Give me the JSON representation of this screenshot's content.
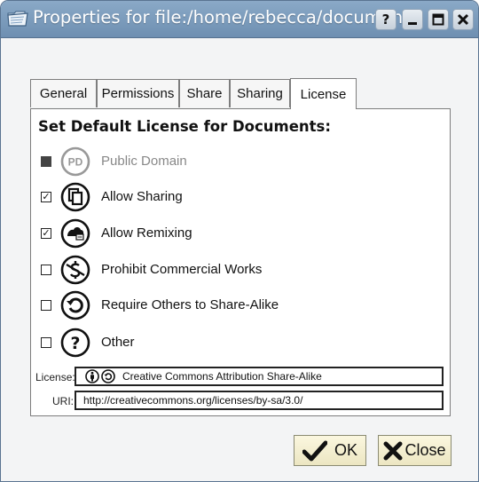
{
  "window": {
    "title": "Properties for file:/home/rebecca/documents"
  },
  "titlebar_buttons": [
    {
      "label": "?",
      "icon": "help-icon"
    },
    {
      "icon": "minimize-icon"
    },
    {
      "icon": "maximize-icon"
    },
    {
      "icon": "close-icon"
    }
  ],
  "tabs": [
    {
      "label": "General"
    },
    {
      "label": "Permissions"
    },
    {
      "label": "Share"
    },
    {
      "label": "Sharing"
    },
    {
      "label": "License",
      "active": true
    }
  ],
  "license_panel": {
    "heading": "Set Default License for Documents:",
    "options": [
      {
        "label": "Public Domain",
        "checked": false,
        "enabled": false,
        "icon": "public-domain-icon",
        "glyph": "PD"
      },
      {
        "label": "Allow Sharing",
        "checked": true,
        "enabled": true,
        "icon": "share-icon"
      },
      {
        "label": "Allow Remixing",
        "checked": true,
        "enabled": true,
        "icon": "remix-icon"
      },
      {
        "label": "Prohibit Commercial Works",
        "checked": false,
        "enabled": true,
        "icon": "noncommercial-icon"
      },
      {
        "label": "Require Others to Share-Alike",
        "checked": false,
        "enabled": true,
        "icon": "share-alike-icon"
      },
      {
        "label": "Other",
        "checked": false,
        "enabled": true,
        "icon": "other-icon",
        "glyph": "?"
      }
    ],
    "license_label": "License:",
    "license_value": "Creative Commons Attribution Share-Alike",
    "uri_label": "URI:",
    "uri_value": "http://creativecommons.org/licenses/by-sa/3.0/"
  },
  "buttons": {
    "ok": "OK",
    "close": "Close"
  }
}
